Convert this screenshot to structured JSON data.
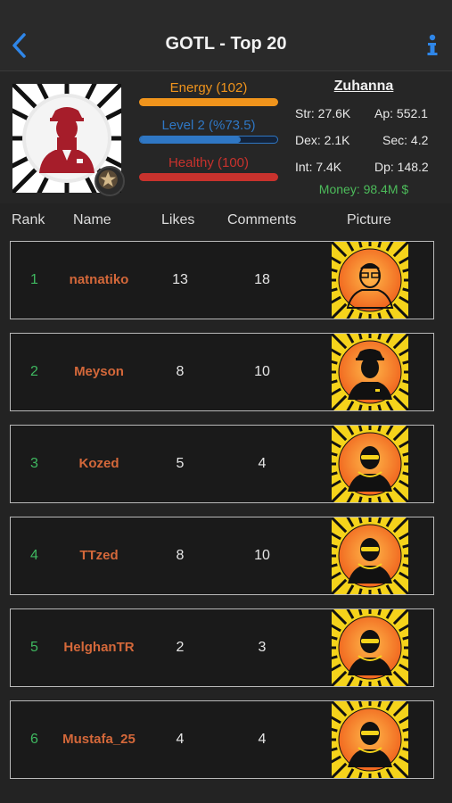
{
  "nav": {
    "title": "GOTL - Top 20"
  },
  "profile": {
    "energy_label": "Energy (102)",
    "level_label": "Level 2 (%73.5)",
    "level_progress": 0.735,
    "health_label": "Healthy (100)",
    "username": "Zuhanna",
    "stats": {
      "str": "Str: 27.6K",
      "ap": "Ap: 552.1",
      "dex": "Dex: 2.1K",
      "sec": "Sec: 4.2",
      "int": "Int: 7.4K",
      "dp": "Dp: 148.2"
    },
    "money": "Money: 98.4M $"
  },
  "columns": {
    "rank": "Rank",
    "name": "Name",
    "likes": "Likes",
    "comments": "Comments",
    "picture": "Picture"
  },
  "rows": [
    {
      "rank": "1",
      "name": "natnatiko",
      "likes": "13",
      "comments": "18",
      "avatar": "glasses-man-icon"
    },
    {
      "rank": "2",
      "name": "Meyson",
      "likes": "8",
      "comments": "10",
      "avatar": "officer-icon"
    },
    {
      "rank": "3",
      "name": "Kozed",
      "likes": "5",
      "comments": "4",
      "avatar": "headphones-man-icon"
    },
    {
      "rank": "4",
      "name": "TTzed",
      "likes": "8",
      "comments": "10",
      "avatar": "headphones-man-icon"
    },
    {
      "rank": "5",
      "name": "HelghanTR",
      "likes": "2",
      "comments": "3",
      "avatar": "headphones-man-icon"
    },
    {
      "rank": "6",
      "name": "Mustafa_25",
      "likes": "4",
      "comments": "4",
      "avatar": "headphones-man-icon"
    }
  ],
  "colors": {
    "energy": "#f0941c",
    "level": "#2f77c4",
    "health": "#c8322d",
    "rank": "#3fb860",
    "name": "#d4683a",
    "money": "#4cbb5a"
  }
}
